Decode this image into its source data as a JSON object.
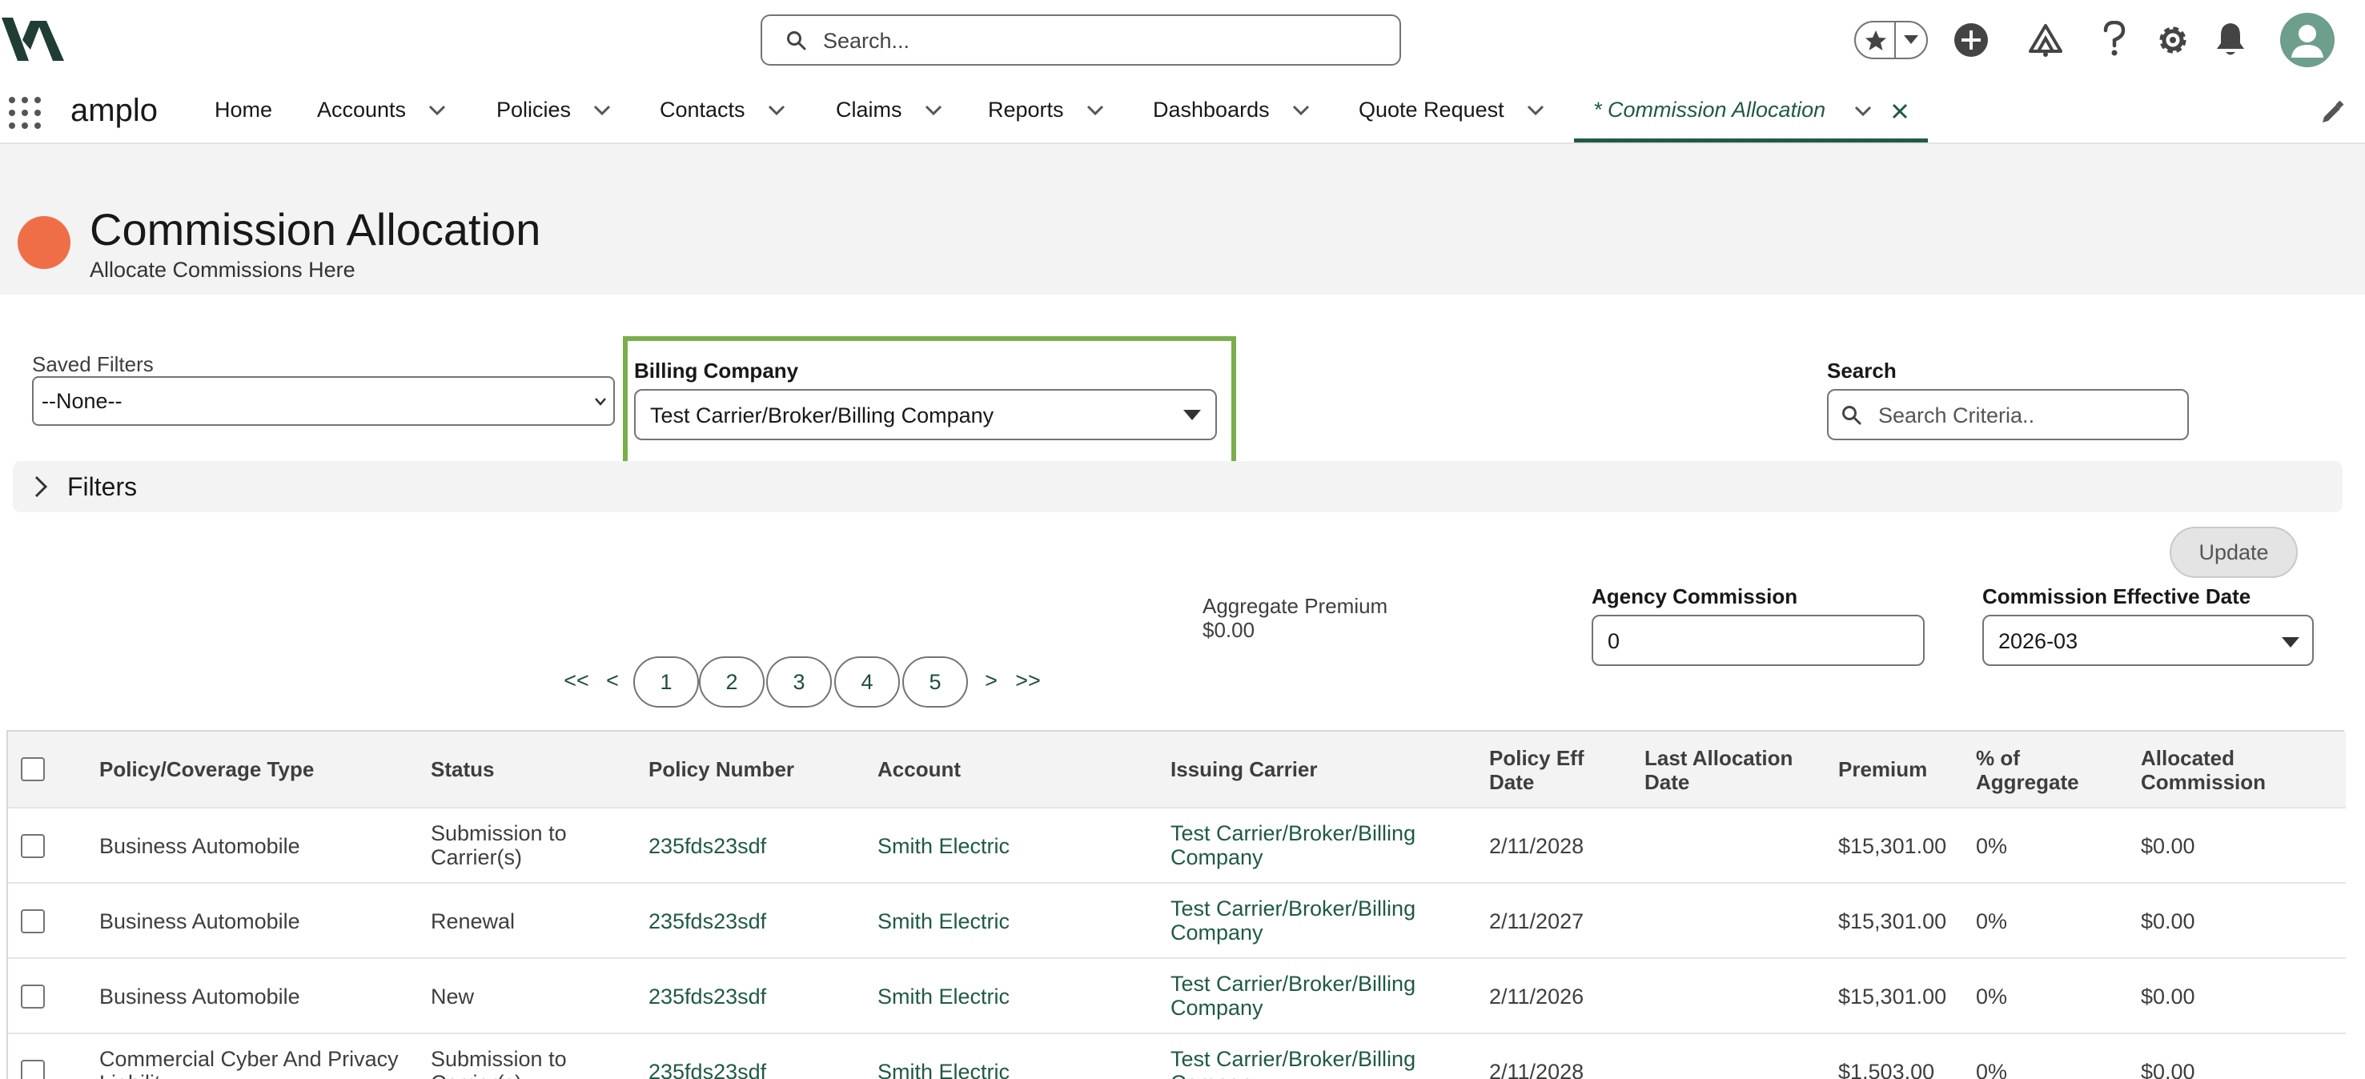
{
  "header": {
    "search_placeholder": "Search...",
    "icons": [
      "logo-icon",
      "favorites-star-icon",
      "add-icon",
      "trailhead-icon",
      "help-icon",
      "settings-gear-icon",
      "notification-bell-icon",
      "user-avatar-icon"
    ]
  },
  "nav": {
    "app_name": "amplo",
    "items": [
      {
        "label": "Home"
      },
      {
        "label": "Accounts"
      },
      {
        "label": "Policies"
      },
      {
        "label": "Contacts"
      },
      {
        "label": "Claims"
      },
      {
        "label": "Reports"
      },
      {
        "label": "Dashboards"
      },
      {
        "label": "Quote Request"
      }
    ],
    "active_tab": "* Commission Allocation"
  },
  "page": {
    "title": "Commission Allocation",
    "subtitle": "Allocate Commissions Here",
    "icon_color": "#ef6e48"
  },
  "filters": {
    "saved_filters_label": "Saved Filters",
    "saved_filters_value": "--None--",
    "billing_company_label": "Billing Company",
    "billing_company_value": "Test Carrier/Broker/Billing Company",
    "search_label": "Search",
    "search_placeholder": "Search Criteria..",
    "filters_section_label": "Filters"
  },
  "commission": {
    "update_label": "Update",
    "aggregate_premium_label": "Aggregate Premium",
    "aggregate_premium_value": "$0.00",
    "agency_commission_label": "Agency Commission",
    "agency_commission_value": "0",
    "effective_date_label": "Commission Effective Date",
    "effective_date_value": "2026-03"
  },
  "pagination": {
    "first": "<<",
    "prev": "<",
    "pages": [
      "1",
      "2",
      "3",
      "4",
      "5"
    ],
    "next": ">",
    "last": ">>"
  },
  "table": {
    "columns": {
      "type": "Policy/Coverage Type",
      "status": "Status",
      "policy_number": "Policy Number",
      "account": "Account",
      "carrier": "Issuing Carrier",
      "eff_date": "Policy Eff Date",
      "last_alloc": "Last Allocation Date",
      "premium": "Premium",
      "pct": "% of Aggregate",
      "alloc_comm": "Allocated Commission"
    },
    "rows": [
      {
        "type": "Business Automobile",
        "status": "Submission to Carrier(s)",
        "policy_number": "235fds23sdf",
        "account": "Smith Electric",
        "carrier": "Test Carrier/Broker/Billing Company",
        "eff_date": "2/11/2028",
        "last_alloc": "",
        "premium": "$15,301.00",
        "pct": "0%",
        "alloc_comm": "$0.00"
      },
      {
        "type": "Business Automobile",
        "status": "Renewal",
        "policy_number": "235fds23sdf",
        "account": "Smith Electric",
        "carrier": "Test Carrier/Broker/Billing Company",
        "eff_date": "2/11/2027",
        "last_alloc": "",
        "premium": "$15,301.00",
        "pct": "0%",
        "alloc_comm": "$0.00"
      },
      {
        "type": "Business Automobile",
        "status": "New",
        "policy_number": "235fds23sdf",
        "account": "Smith Electric",
        "carrier": "Test Carrier/Broker/Billing Company",
        "eff_date": "2/11/2026",
        "last_alloc": "",
        "premium": "$15,301.00",
        "pct": "0%",
        "alloc_comm": "$0.00"
      },
      {
        "type": "Commercial Cyber And Privacy Liability",
        "status": "Submission to Carrier(s)",
        "policy_number": "235fds23sdf",
        "account": "Smith Electric",
        "carrier": "Test Carrier/Broker/Billing Company",
        "eff_date": "2/11/2028",
        "last_alloc": "",
        "premium": "$1,503.00",
        "pct": "0%",
        "alloc_comm": "$0.00"
      }
    ]
  },
  "colors": {
    "brand_dark": "#1f3d34",
    "link": "#1f5a43",
    "highlight_border": "#7bad4c"
  }
}
